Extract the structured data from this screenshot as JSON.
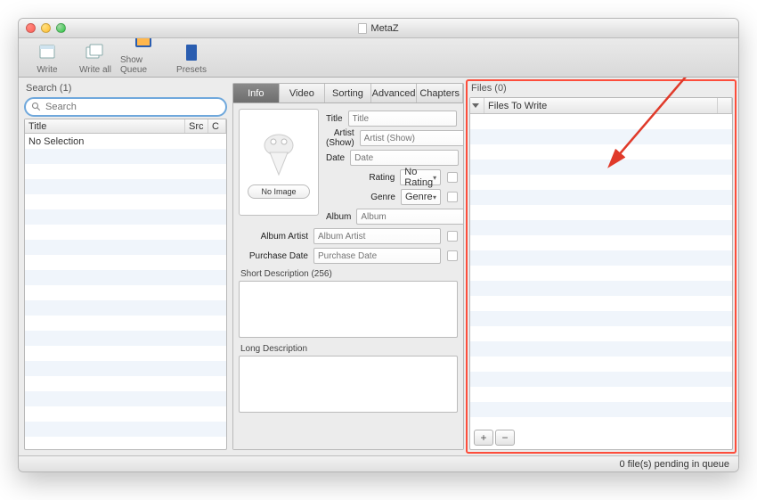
{
  "window": {
    "title": "MetaZ"
  },
  "toolbar": {
    "write": "Write",
    "write_all": "Write all",
    "show_queue": "Show Queue",
    "presets": "Presets"
  },
  "search": {
    "label": "Search (1)",
    "placeholder": "Search",
    "columns": {
      "title": "Title",
      "src": "Src",
      "c": "C"
    },
    "rows": [
      "No Selection"
    ]
  },
  "tabs": [
    "Info",
    "Video",
    "Sorting",
    "Advanced",
    "Chapters"
  ],
  "active_tab": 0,
  "artwork": {
    "no_image": "No Image"
  },
  "fields": {
    "title": {
      "label": "Title",
      "placeholder": "Title"
    },
    "artist_show": {
      "label": "Artist (Show)",
      "placeholder": "Artist (Show)"
    },
    "date": {
      "label": "Date",
      "placeholder": "Date"
    },
    "rating": {
      "label": "Rating",
      "placeholder": "No Rating"
    },
    "genre": {
      "label": "Genre",
      "placeholder": "Genre"
    },
    "album": {
      "label": "Album",
      "placeholder": "Album"
    },
    "album_artist": {
      "label": "Album Artist",
      "placeholder": "Album Artist"
    },
    "purchase_date": {
      "label": "Purchase Date",
      "placeholder": "Purchase Date"
    }
  },
  "descriptions": {
    "short_label": "Short Description (256)",
    "long_label": "Long Description"
  },
  "files": {
    "label": "Files (0)",
    "header": "Files To Write",
    "add": "+",
    "remove": "−"
  },
  "status": "0 file(s) pending in queue"
}
